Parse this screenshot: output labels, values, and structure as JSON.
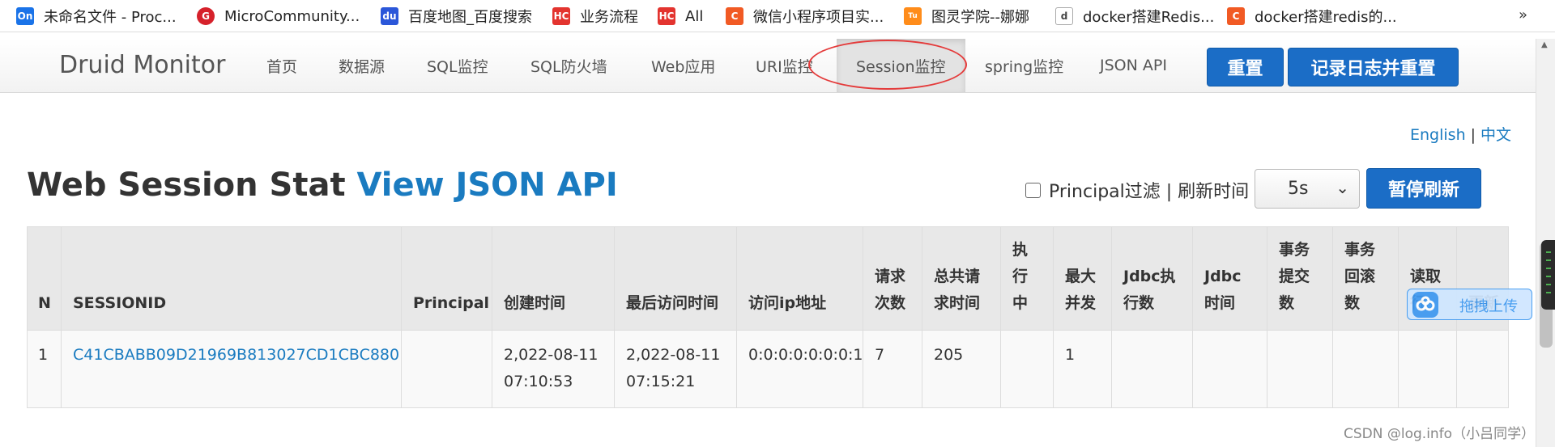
{
  "bookmarks": [
    {
      "icon_text": "On",
      "icon_color": "#1a73e8",
      "label": "未命名文件 - Proc..."
    },
    {
      "icon_text": "G",
      "icon_color": "#d6212b",
      "label": "MicroCommunity..."
    },
    {
      "icon_text": "du",
      "icon_color": "#2b57d9",
      "label": "百度地图_百度搜索"
    },
    {
      "icon_text": "HC",
      "icon_color": "#e3342f",
      "label": "业务流程"
    },
    {
      "icon_text": "HC",
      "icon_color": "#e3342f",
      "label": "All"
    },
    {
      "icon_text": "C",
      "icon_color": "#f15a24",
      "label": "微信小程序项目实..."
    },
    {
      "icon_text": "Tu",
      "icon_color": "#ff8c1a",
      "label": "图灵学院--娜娜"
    },
    {
      "icon_text": "d",
      "icon_color": "#555555",
      "label": "docker搭建Redis..."
    },
    {
      "icon_text": "C",
      "icon_color": "#f15a24",
      "label": "docker搭建redis的..."
    }
  ],
  "bookmarks_overflow": "»",
  "navbar": {
    "brand": "Druid Monitor",
    "items": [
      "首页",
      "数据源",
      "SQL监控",
      "SQL防火墙",
      "Web应用",
      "URI监控",
      "Session监控",
      "spring监控",
      "JSON API"
    ],
    "active_item": "Session监控",
    "reset_button": "重置",
    "log_reset_button": "记录日志并重置"
  },
  "lang": {
    "english": "English",
    "separator": "|",
    "chinese": "中文"
  },
  "page": {
    "title": "Web Session Stat",
    "json_link": "View JSON API",
    "principal_filter_label": "Principal过滤 | 刷新时间",
    "principal_filter_checked": false,
    "refresh_interval": "5s",
    "pause_button": "暂停刷新"
  },
  "table": {
    "headers": [
      [
        "N"
      ],
      [
        "SESSIONID"
      ],
      [
        "Principal"
      ],
      [
        "创建时间"
      ],
      [
        "最后访问时间"
      ],
      [
        "访问ip地址"
      ],
      [
        "请求",
        "次数"
      ],
      [
        "总共请",
        "求时间"
      ],
      [
        "执",
        "行",
        "中"
      ],
      [
        "最大",
        "并发"
      ],
      [
        "Jdbc执",
        "行数"
      ],
      [
        "Jdbc",
        "时间"
      ],
      [
        "事务",
        "提交",
        "数"
      ],
      [
        "事务",
        "回滚",
        "数"
      ],
      [
        "读取",
        "行"
      ],
      [
        "更新",
        ""
      ]
    ],
    "rows": [
      {
        "n": "1",
        "session_id": "C41CBABB09D21969B813027CD1CBC880",
        "principal": "",
        "created": [
          "2,022-08-11",
          "07:10:53"
        ],
        "last_access": [
          "2,022-08-11",
          "07:15:21"
        ],
        "ip": "0:0:0:0:0:0:0:1",
        "request_count": "7",
        "request_time_total": "205",
        "running": "",
        "concurrent_max": "1",
        "jdbc_execute_count": "",
        "jdbc_time": "",
        "tx_commit": "",
        "tx_rollback": "",
        "fetch_rows": "",
        "update_rows": ""
      }
    ]
  },
  "upload_widget": {
    "label": "拖拽上传"
  },
  "watermark": "CSDN @log.info（小吕同学）"
}
